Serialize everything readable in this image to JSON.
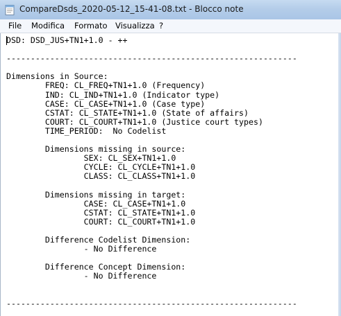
{
  "window": {
    "title": "CompareDsds_2020-05-12_15-41-08.txt - Blocco note",
    "icon": "notepad-icon"
  },
  "menu": {
    "items": [
      "File",
      "Modifica",
      "Formato",
      "Visualizza",
      "?"
    ]
  },
  "document": {
    "text": "DSD: DSD_JUS+TN1+1.0 - ++\n\n------------------------------------------------------------\n\nDimensions in Source:\n        FREQ: CL_FREQ+TN1+1.0 (Frequency)\n        IND: CL_IND+TN1+1.0 (Indicator type)\n        CASE: CL_CASE+TN1+1.0 (Case type)\n        CSTAT: CL_STATE+TN1+1.0 (State of affairs)\n        COURT: CL_COURT+TN1+1.0 (Justice court types)\n        TIME_PERIOD:  No Codelist\n\n        Dimensions missing in source:\n                SEX: CL_SEX+TN1+1.0\n                CYCLE: CL_CYCLE+TN1+1.0\n                CLASS: CL_CLASS+TN1+1.0\n\n        Dimensions missing in target:\n                CASE: CL_CASE+TN1+1.0\n                CSTAT: CL_STATE+TN1+1.0\n                COURT: CL_COURT+TN1+1.0\n\n        Difference Codelist Dimension:\n                - No Difference\n\n        Difference Concept Dimension:\n                - No Difference\n\n\n------------------------------------------------------------"
  }
}
